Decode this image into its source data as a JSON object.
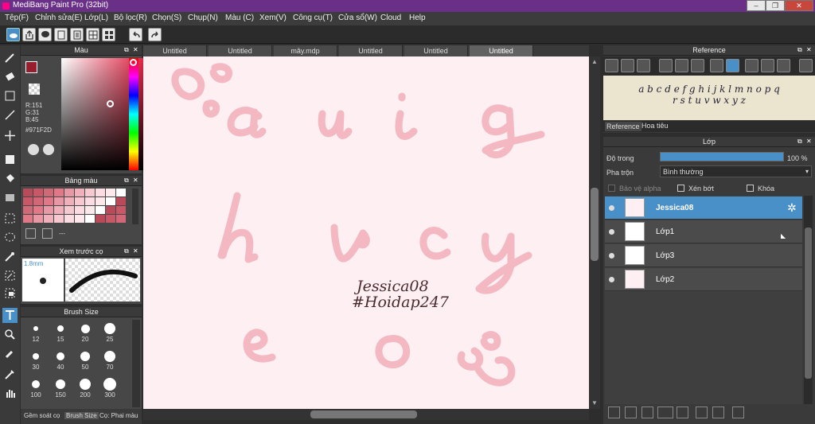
{
  "app": {
    "title": "MediBang Paint Pro (32bit)"
  },
  "menu": [
    "Tệp(F)",
    "Chỉnh sửa(E)",
    "Lớp(L)",
    "Bộ lọc(R)",
    "Chọn(S)",
    "Chụp(N)",
    "Màu (C)",
    "Xem(V)",
    "Công cụ(T)",
    "Cửa sổ(W)",
    "Cloud",
    "Help"
  ],
  "color_panel": {
    "title": "Màu",
    "r": "R:151",
    "g": "G:31",
    "b": "B:45",
    "hex": "#971F2D",
    "fg_color": "#971F2D"
  },
  "palette_panel": {
    "title": "Bảng màu",
    "dash": "---"
  },
  "brush_preview": {
    "title": "Xem trước cọ",
    "size": "1.8mm"
  },
  "brush_size": {
    "title": "Brush Size",
    "sizes": [
      "12",
      "15",
      "20",
      "25",
      "30",
      "40",
      "50",
      "70",
      "100",
      "150",
      "200",
      "300"
    ]
  },
  "bottom_tabs": [
    "Gềm soát cọ",
    "Brush Size",
    "Cọ: Phai màu"
  ],
  "tabs": [
    "Untitled",
    "Untitled",
    "mây.mdp",
    "Untitled",
    "Untitled",
    "Untitled"
  ],
  "canvas": {
    "line1": "Jessica08",
    "line2": "#Hoidap247"
  },
  "reference": {
    "title": "Reference",
    "text1": "a b c d e f g h i j k l m n o p q",
    "text2": "r s t u v w x y z",
    "tab1": "Reference",
    "tab2": "Hoa tiêu"
  },
  "layers": {
    "title": "Lớp",
    "opacity_label": "Độ trong",
    "opacity_value": "100 %",
    "opacity": 1.0,
    "blend_label": "Pha trộn",
    "blend_value": "Bình thường",
    "protect_alpha": "Bảo vệ alpha",
    "clipping": "Xén bớt",
    "lock": "Khóa",
    "items": [
      {
        "name": "Jessica08"
      },
      {
        "name": "Lớp1"
      },
      {
        "name": "Lớp3"
      },
      {
        "name": "Lớp2"
      }
    ]
  },
  "colors": {
    "accent": "#4a90c8",
    "canvas_bg": "#fdeff2",
    "letter": "#f3b8c2"
  }
}
